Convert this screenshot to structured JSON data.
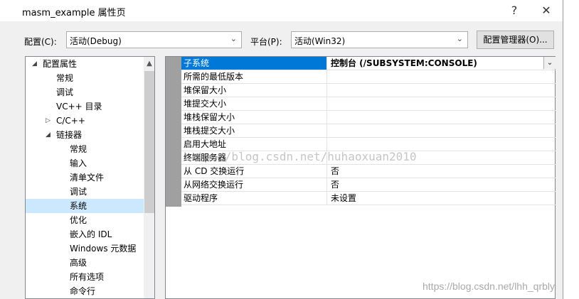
{
  "window": {
    "title": "masm_example 属性页",
    "help_label": "?",
    "close_label": "✕"
  },
  "toolbar": {
    "config_label": "配置(C):",
    "config_value": "活动(Debug)",
    "platform_label": "平台(P):",
    "platform_value": "活动(Win32)",
    "config_manager_label": "配置管理器(O)..."
  },
  "tree": {
    "items": [
      {
        "label": "配置属性",
        "expander": "◢"
      },
      {
        "label": "常规"
      },
      {
        "label": "调试"
      },
      {
        "label": "VC++ 目录"
      },
      {
        "label": "C/C++",
        "expander": "▷"
      },
      {
        "label": "链接器",
        "expander": "◢"
      },
      {
        "label": "常规"
      },
      {
        "label": "输入"
      },
      {
        "label": "清单文件"
      },
      {
        "label": "调试"
      },
      {
        "label": "系统",
        "selected": true
      },
      {
        "label": "优化"
      },
      {
        "label": "嵌入的 IDL"
      },
      {
        "label": "Windows 元数据"
      },
      {
        "label": "高级"
      },
      {
        "label": "所有选项"
      },
      {
        "label": "命令行"
      }
    ]
  },
  "properties": [
    {
      "name": "子系统",
      "value": "控制台 (/SUBSYSTEM:CONSOLE)",
      "selected": true
    },
    {
      "name": "所需的最低版本",
      "value": ""
    },
    {
      "name": "堆保留大小",
      "value": ""
    },
    {
      "name": "堆提交大小",
      "value": ""
    },
    {
      "name": "堆栈保留大小",
      "value": ""
    },
    {
      "name": "堆栈提交大小",
      "value": ""
    },
    {
      "name": "启用大地址",
      "value": ""
    },
    {
      "name": "终端服务器",
      "value": ""
    },
    {
      "name": "从 CD 交换运行",
      "value": "否"
    },
    {
      "name": "从网络交换运行",
      "value": "否"
    },
    {
      "name": "驱动程序",
      "value": "未设置"
    }
  ],
  "watermarks": {
    "overlay": "http://blog.csdn.net/huhaoxuan2010",
    "corner": "https://blog.csdn.net/lhh_qrbly"
  }
}
